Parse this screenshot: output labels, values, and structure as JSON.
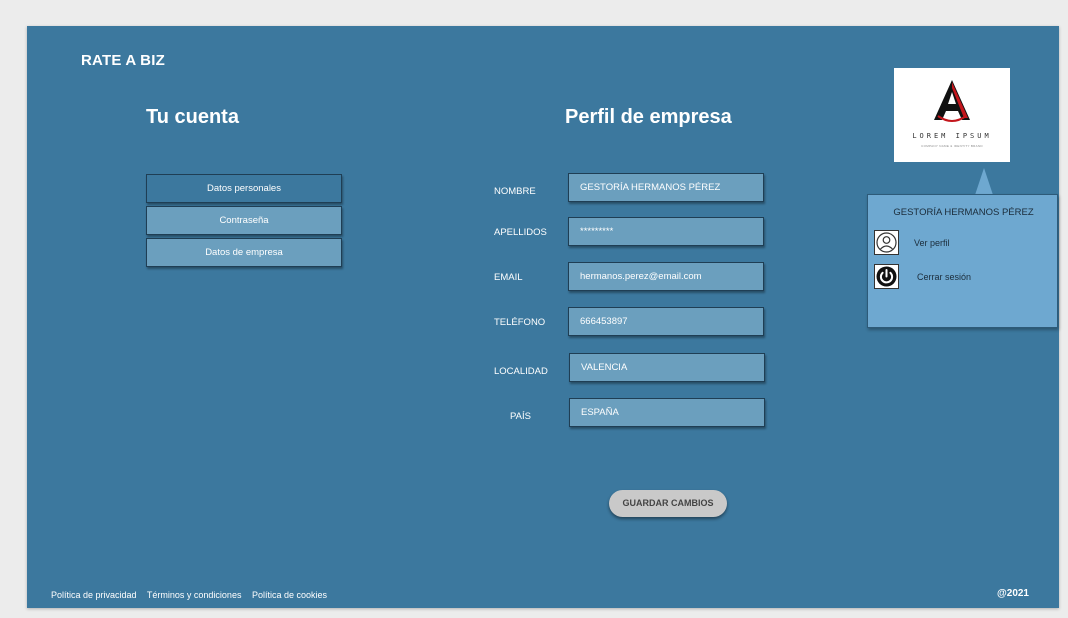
{
  "brand": "RATE A BIZ",
  "account": {
    "title": "Tu cuenta",
    "menu": [
      {
        "label": "Datos personales"
      },
      {
        "label": "Contraseña"
      },
      {
        "label": "Datos de empresa"
      }
    ]
  },
  "profile": {
    "title": "Perfil de empresa",
    "fields": [
      {
        "label": "NOMBRE",
        "value": "GESTORÍA HERMANOS PÉREZ"
      },
      {
        "label": "APELLIDOS",
        "value": "*********"
      },
      {
        "label": "EMAIL",
        "value": "hermanos.perez@email.com"
      },
      {
        "label": "TELÉFONO",
        "value": "666453897"
      },
      {
        "label": "LOCALIDAD",
        "value": "VALENCIA"
      },
      {
        "label": "PAÍS",
        "value": "ESPAÑA"
      }
    ],
    "save_label": "GUARDAR CAMBIOS"
  },
  "logo": {
    "letter": "A",
    "text": "LOREM IPSUM",
    "subtext": "COMPANY NAME & IDENTITY BRAND"
  },
  "user_menu": {
    "name": "GESTORÍA HERMANOS PÉREZ",
    "items": [
      {
        "label": "Ver perfil",
        "icon": "user-icon"
      },
      {
        "label": "Cerrar sesión",
        "icon": "power-icon"
      }
    ]
  },
  "footer": {
    "links": [
      "Política de privacidad",
      "Términos y condiciones",
      "Política de cookies"
    ],
    "copyright": "@2021"
  },
  "colors": {
    "background": "#3c789e",
    "field": "#6b9fbe",
    "dropdown": "#6ea8d0",
    "save_button": "#c9c9c9"
  }
}
